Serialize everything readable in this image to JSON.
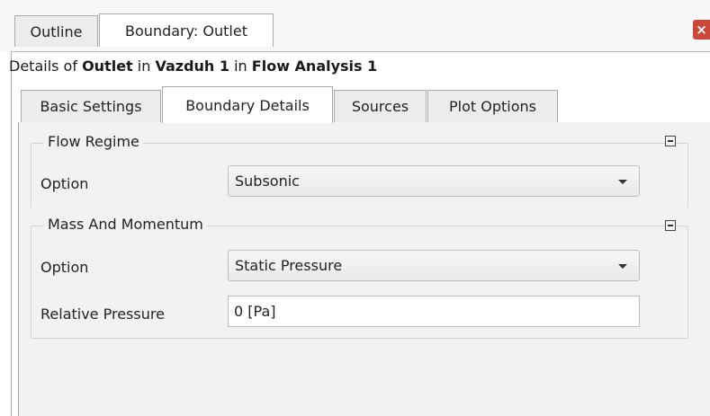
{
  "outer_tabs": [
    {
      "label": "Outline"
    },
    {
      "label": "Boundary: Outlet"
    }
  ],
  "details": {
    "prefix": "Details of ",
    "object": "Outlet",
    "in1": " in ",
    "domain": "Vazduh 1",
    "in2": " in ",
    "analysis": "Flow Analysis 1"
  },
  "inner_tabs": [
    {
      "label": "Basic Settings"
    },
    {
      "label": "Boundary Details"
    },
    {
      "label": "Sources"
    },
    {
      "label": "Plot Options"
    }
  ],
  "flow_regime": {
    "title": "Flow Regime",
    "option_label": "Option",
    "option_value": "Subsonic"
  },
  "mass_momentum": {
    "title": "Mass And Momentum",
    "option_label": "Option",
    "option_value": "Static Pressure",
    "pressure_label": "Relative Pressure",
    "pressure_value": "0 [Pa]"
  },
  "icons": {
    "close": "close-icon",
    "collapse": "collapse-icon",
    "dropdown": "chevron-down-icon"
  },
  "colors": {
    "close_button": "#c9473b",
    "panel_background": "#f2f2f2"
  }
}
